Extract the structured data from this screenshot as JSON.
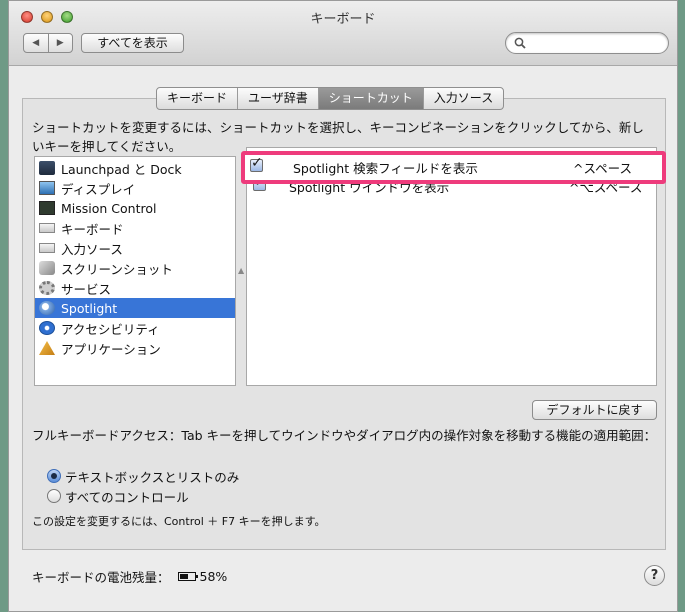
{
  "window": {
    "title": "キーボード"
  },
  "toolbar": {
    "back": "◀",
    "forward": "▶",
    "show_all": "すべてを表示",
    "search_placeholder": ""
  },
  "tabs": [
    {
      "label": "キーボード",
      "active": false
    },
    {
      "label": "ユーザ辞書",
      "active": false
    },
    {
      "label": "ショートカット",
      "active": true
    },
    {
      "label": "入力ソース",
      "active": false
    }
  ],
  "description": "ショートカットを変更するには、ショートカットを選択し、キーコンビネーションをクリックしてから、新しいキーを押してください。",
  "categories": [
    {
      "label": "Launchpad と Dock",
      "icon": "launchpad-icon"
    },
    {
      "label": "ディスプレイ",
      "icon": "display-icon"
    },
    {
      "label": "Mission Control",
      "icon": "mission-control-icon"
    },
    {
      "label": "キーボード",
      "icon": "keyboard-icon"
    },
    {
      "label": "入力ソース",
      "icon": "keyboard-icon"
    },
    {
      "label": "スクリーンショット",
      "icon": "screenshot-icon"
    },
    {
      "label": "サービス",
      "icon": "gear-icon"
    },
    {
      "label": "Spotlight",
      "icon": "spotlight-icon",
      "selected": true
    },
    {
      "label": "アクセシビリティ",
      "icon": "accessibility-icon"
    },
    {
      "label": "アプリケーション",
      "icon": "app-icon"
    }
  ],
  "shortcuts": [
    {
      "name": "Spotlight 検索フィールドを表示",
      "key": "^スペース",
      "checked": true
    },
    {
      "name": "Spotlight ウインドウを表示",
      "key": "^⌥スペース",
      "checked": true
    }
  ],
  "defaults_button": "デフォルトに戻す",
  "full_keyboard_access": {
    "label": "フルキーボードアクセス：Tab キーを押してウインドウやダイアログ内の操作対象を移動する機能の適用範囲：",
    "options": [
      {
        "label": "テキストボックスとリストのみ",
        "selected": true
      },
      {
        "label": "すべてのコントロール",
        "selected": false
      }
    ],
    "note": "この設定を変更するには、Control ＋ F7 キーを押します。"
  },
  "battery": {
    "label": "キーボードの電池残量：",
    "value": "58%"
  },
  "help": "?",
  "colors": {
    "highlight": "#ee3b7c",
    "selection": "#3875d7"
  }
}
